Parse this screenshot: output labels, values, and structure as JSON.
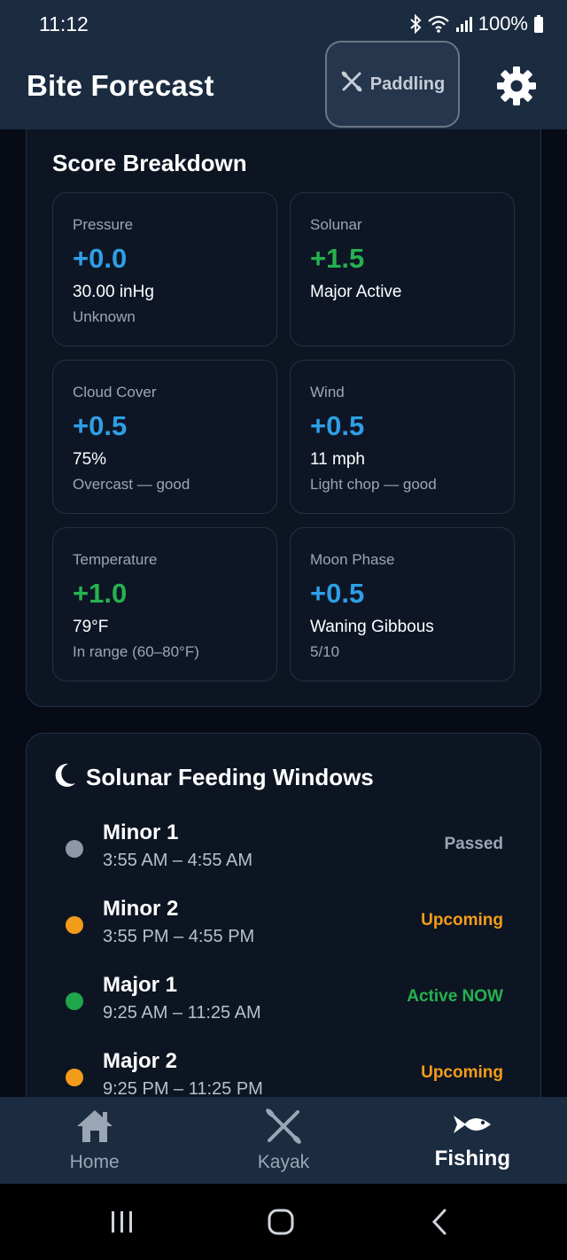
{
  "status_bar": {
    "time": "11:12",
    "battery": "100%"
  },
  "app_bar": {
    "title": "Bite Forecast",
    "paddling_label": "Paddling"
  },
  "score_breakdown": {
    "title": "Score Breakdown",
    "tiles": [
      {
        "label": "Pressure",
        "score": "+0.0",
        "value": "30.00 inHg",
        "note": "Unknown",
        "color": "#2e9fe6"
      },
      {
        "label": "Solunar",
        "score": "+1.5",
        "value": "Major Active",
        "note": "",
        "color": "#26b24f"
      },
      {
        "label": "Cloud Cover",
        "score": "+0.5",
        "value": "75%",
        "note": "Overcast — good",
        "color": "#2e9fe6"
      },
      {
        "label": "Wind",
        "score": "+0.5",
        "value": "11 mph",
        "note": "Light chop — good",
        "color": "#2e9fe6"
      },
      {
        "label": "Temperature",
        "score": "+1.0",
        "value": "79°F",
        "note": "In range (60–80°F)",
        "color": "#26b24f"
      },
      {
        "label": "Moon Phase",
        "score": "+0.5",
        "value": "Waning Gibbous",
        "note": "5/10",
        "color": "#2e9fe6"
      }
    ]
  },
  "solunar": {
    "title": "Solunar Feeding Windows",
    "windows": [
      {
        "name": "Minor 1",
        "time": "3:55 AM – 4:55 AM",
        "status": "Passed",
        "dot_color": "#8d97a8",
        "status_color": "#9aa6b6"
      },
      {
        "name": "Minor 2",
        "time": "3:55 PM – 4:55 PM",
        "status": "Upcoming",
        "dot_color": "#f39c1a",
        "status_color": "#f39c1a"
      },
      {
        "name": "Major 1",
        "time": "9:25 AM – 11:25 AM",
        "status": "Active NOW",
        "dot_color": "#1fa64a",
        "status_color": "#26b24f"
      },
      {
        "name": "Major 2",
        "time": "9:25 PM – 11:25 PM",
        "status": "Upcoming",
        "dot_color": "#f39c1a",
        "status_color": "#f39c1a"
      }
    ]
  },
  "bottom_nav": {
    "items": [
      {
        "label": "Home",
        "icon": "home-icon"
      },
      {
        "label": "Kayak",
        "icon": "kayak-icon"
      },
      {
        "label": "Fishing",
        "icon": "fish-icon"
      }
    ]
  },
  "colors": {
    "background": "#060b16",
    "bar": "#1b2b40",
    "card": "#0d1523",
    "blue": "#2e9fe6",
    "green": "#26b24f",
    "orange": "#f39c1a"
  }
}
